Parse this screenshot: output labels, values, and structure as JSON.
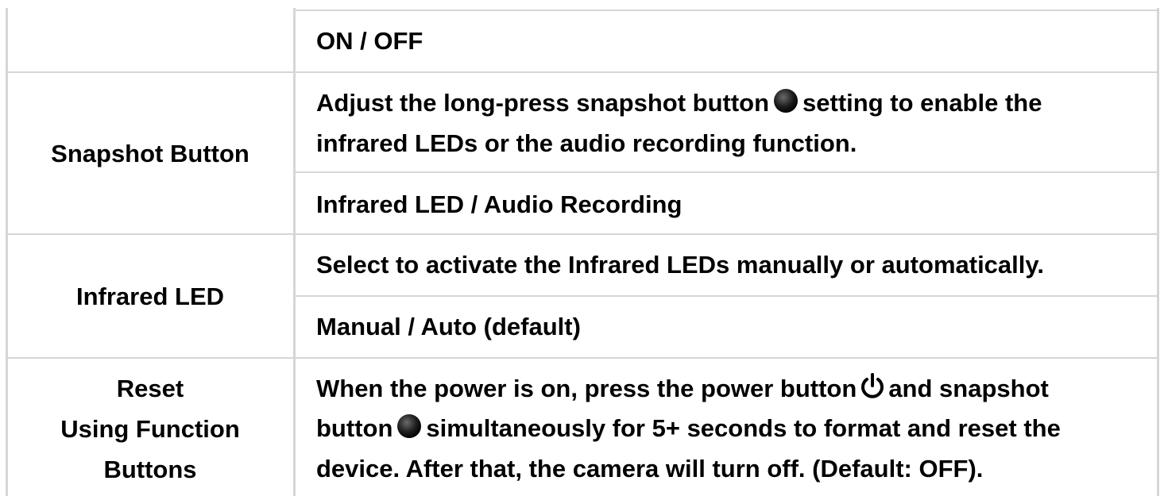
{
  "rows": {
    "row1": {
      "value": "ON / OFF"
    },
    "snapshot": {
      "label": "Snapshot Button",
      "desc_part1": "Adjust the long-press snapshot button",
      "desc_part2": "setting to enable the",
      "desc_line2": "infrared LEDs or the audio recording function.",
      "options": "Infrared LED / Audio Recording"
    },
    "infrared": {
      "label": "Infrared LED",
      "desc": "Select to activate the Infrared LEDs manually or automatically.",
      "options": "Manual / Auto (default)"
    },
    "reset": {
      "label_line1": "Reset",
      "label_line2": "Using Function",
      "label_line3": "Buttons",
      "line1_part1": "When the power is on, press the power button",
      "line1_part2": "and snapshot",
      "line2_part1": "button",
      "line2_part2": "simultaneously for 5+ seconds to format and reset the",
      "line3": "device. After that, the camera will turn off. (Default: OFF)."
    }
  },
  "icons": {
    "snapshot": "snapshot-button-icon",
    "power": "power-icon"
  }
}
